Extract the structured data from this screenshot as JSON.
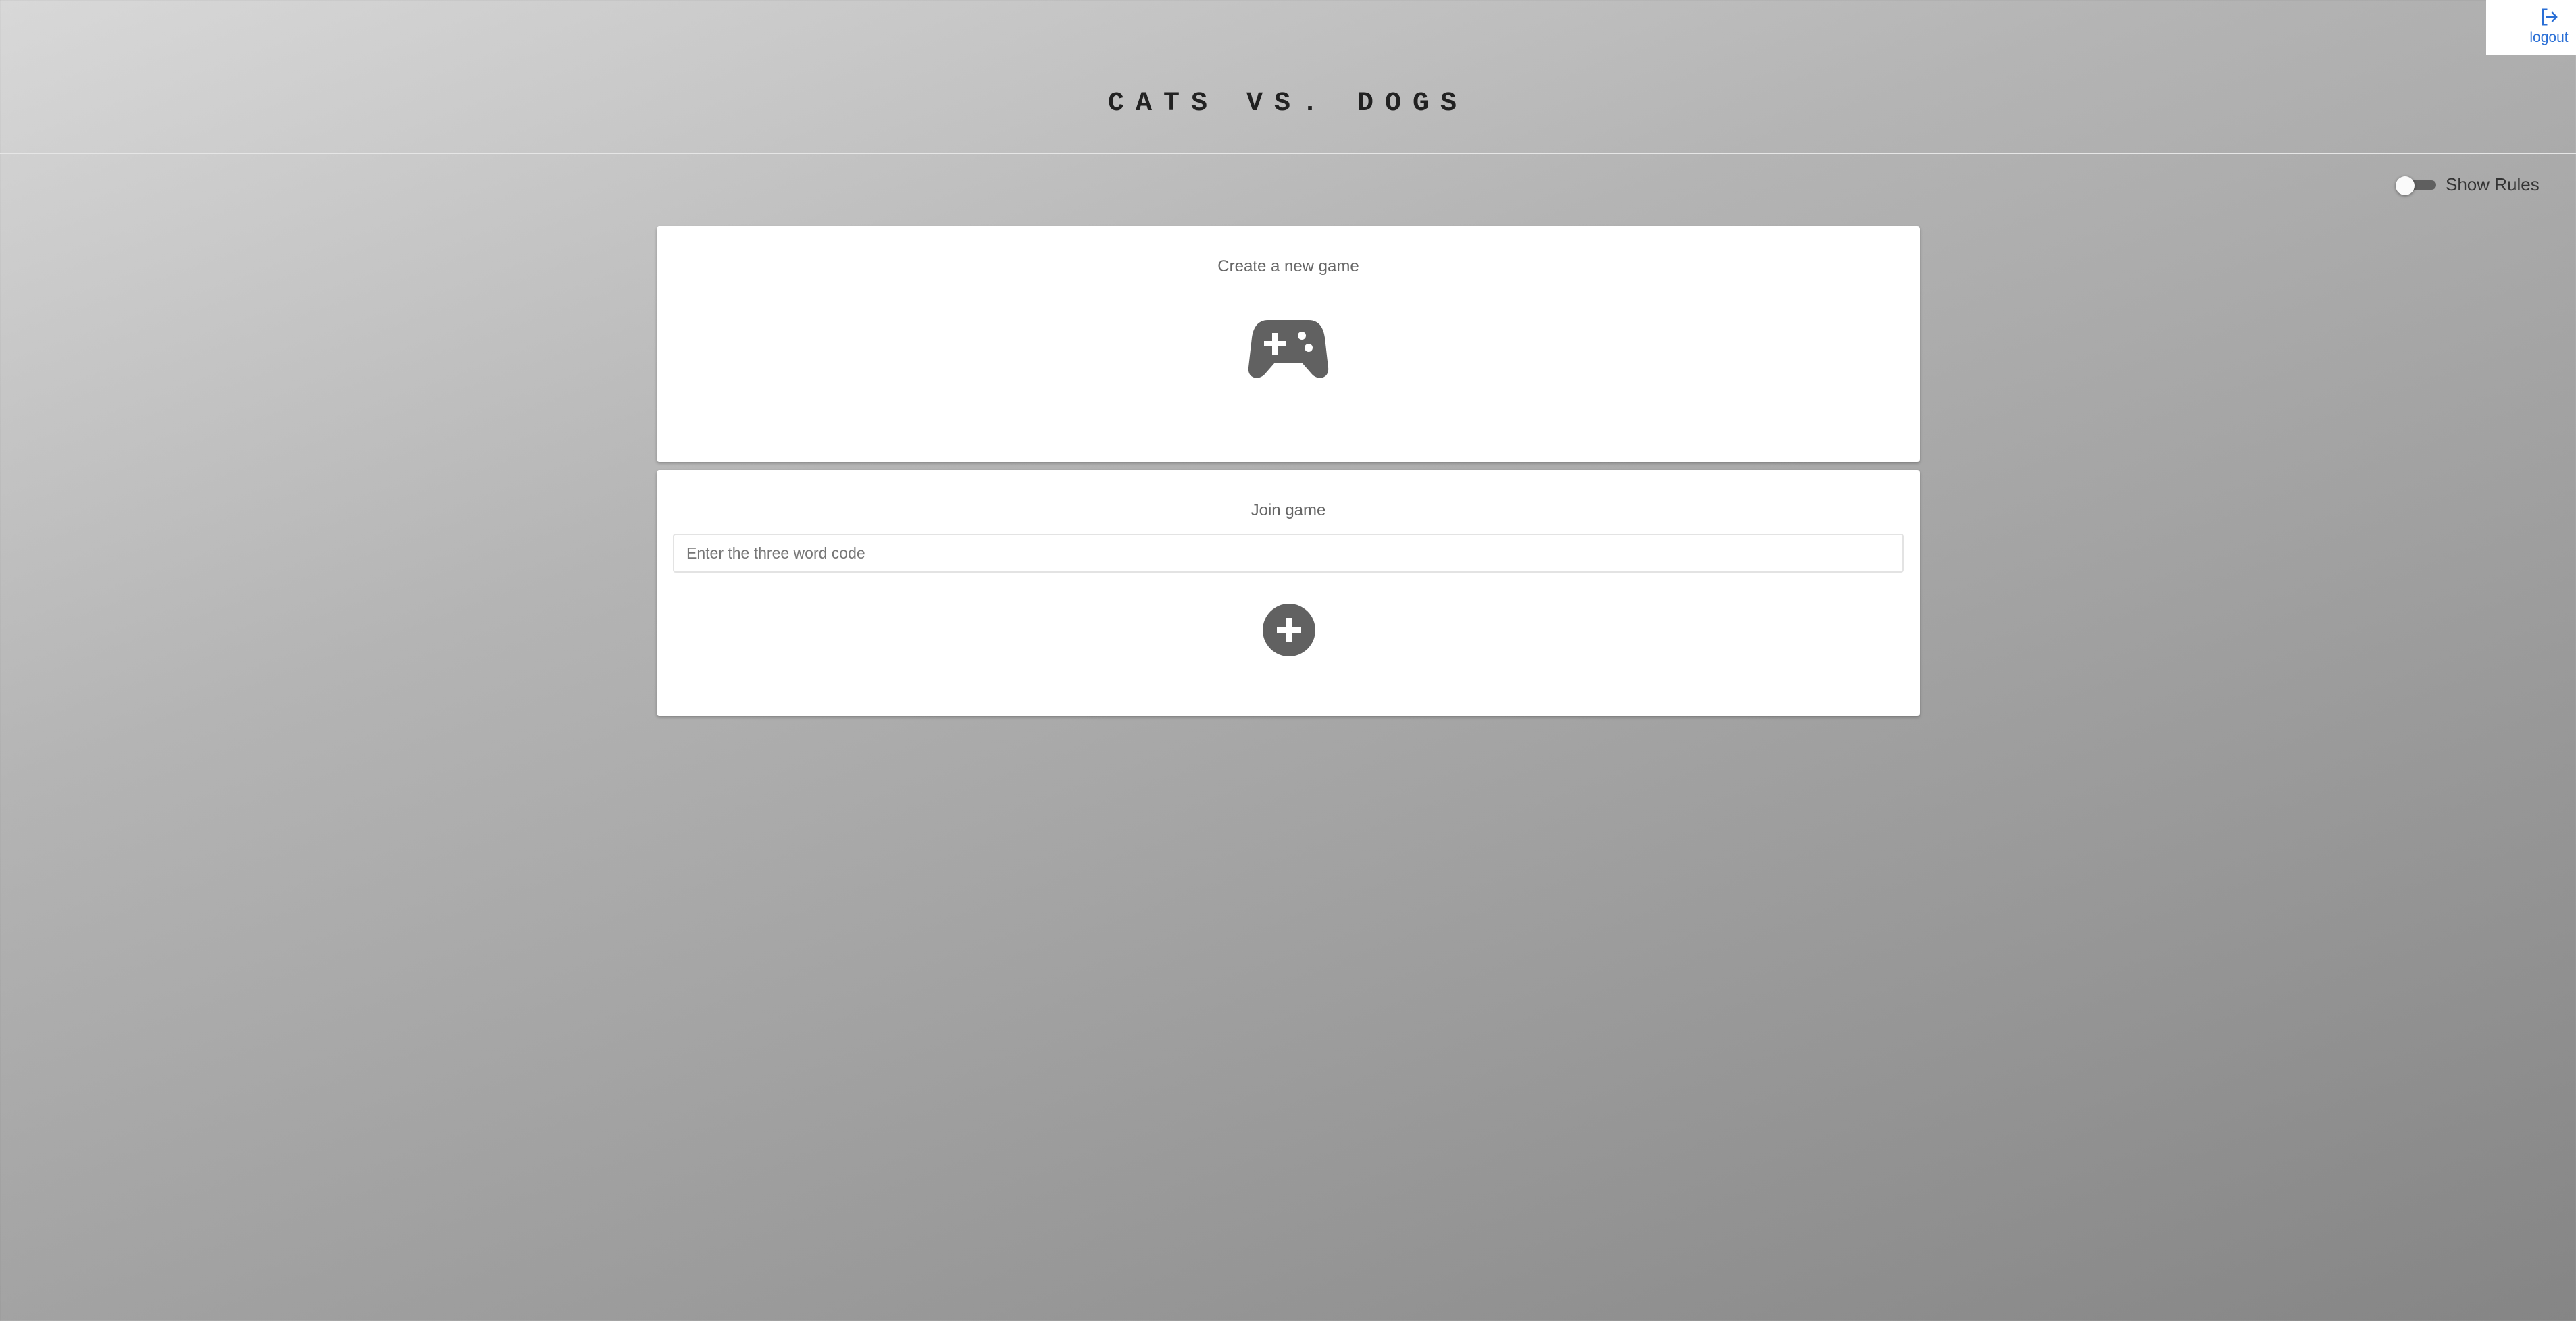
{
  "header": {
    "title": "CATS VS. DOGS",
    "logout_label": "logout"
  },
  "rules_toggle": {
    "label": "Show Rules",
    "checked": false
  },
  "create_card": {
    "title": "Create a new game",
    "button_icon": "gamepad-icon"
  },
  "join_card": {
    "title": "Join game",
    "input_placeholder": "Enter the three word code",
    "input_value": "",
    "button_icon": "plus-circle-icon"
  },
  "colors": {
    "accent_link": "#2a6fd6",
    "icon_gray": "#616161",
    "card_bg": "#ffffff"
  }
}
